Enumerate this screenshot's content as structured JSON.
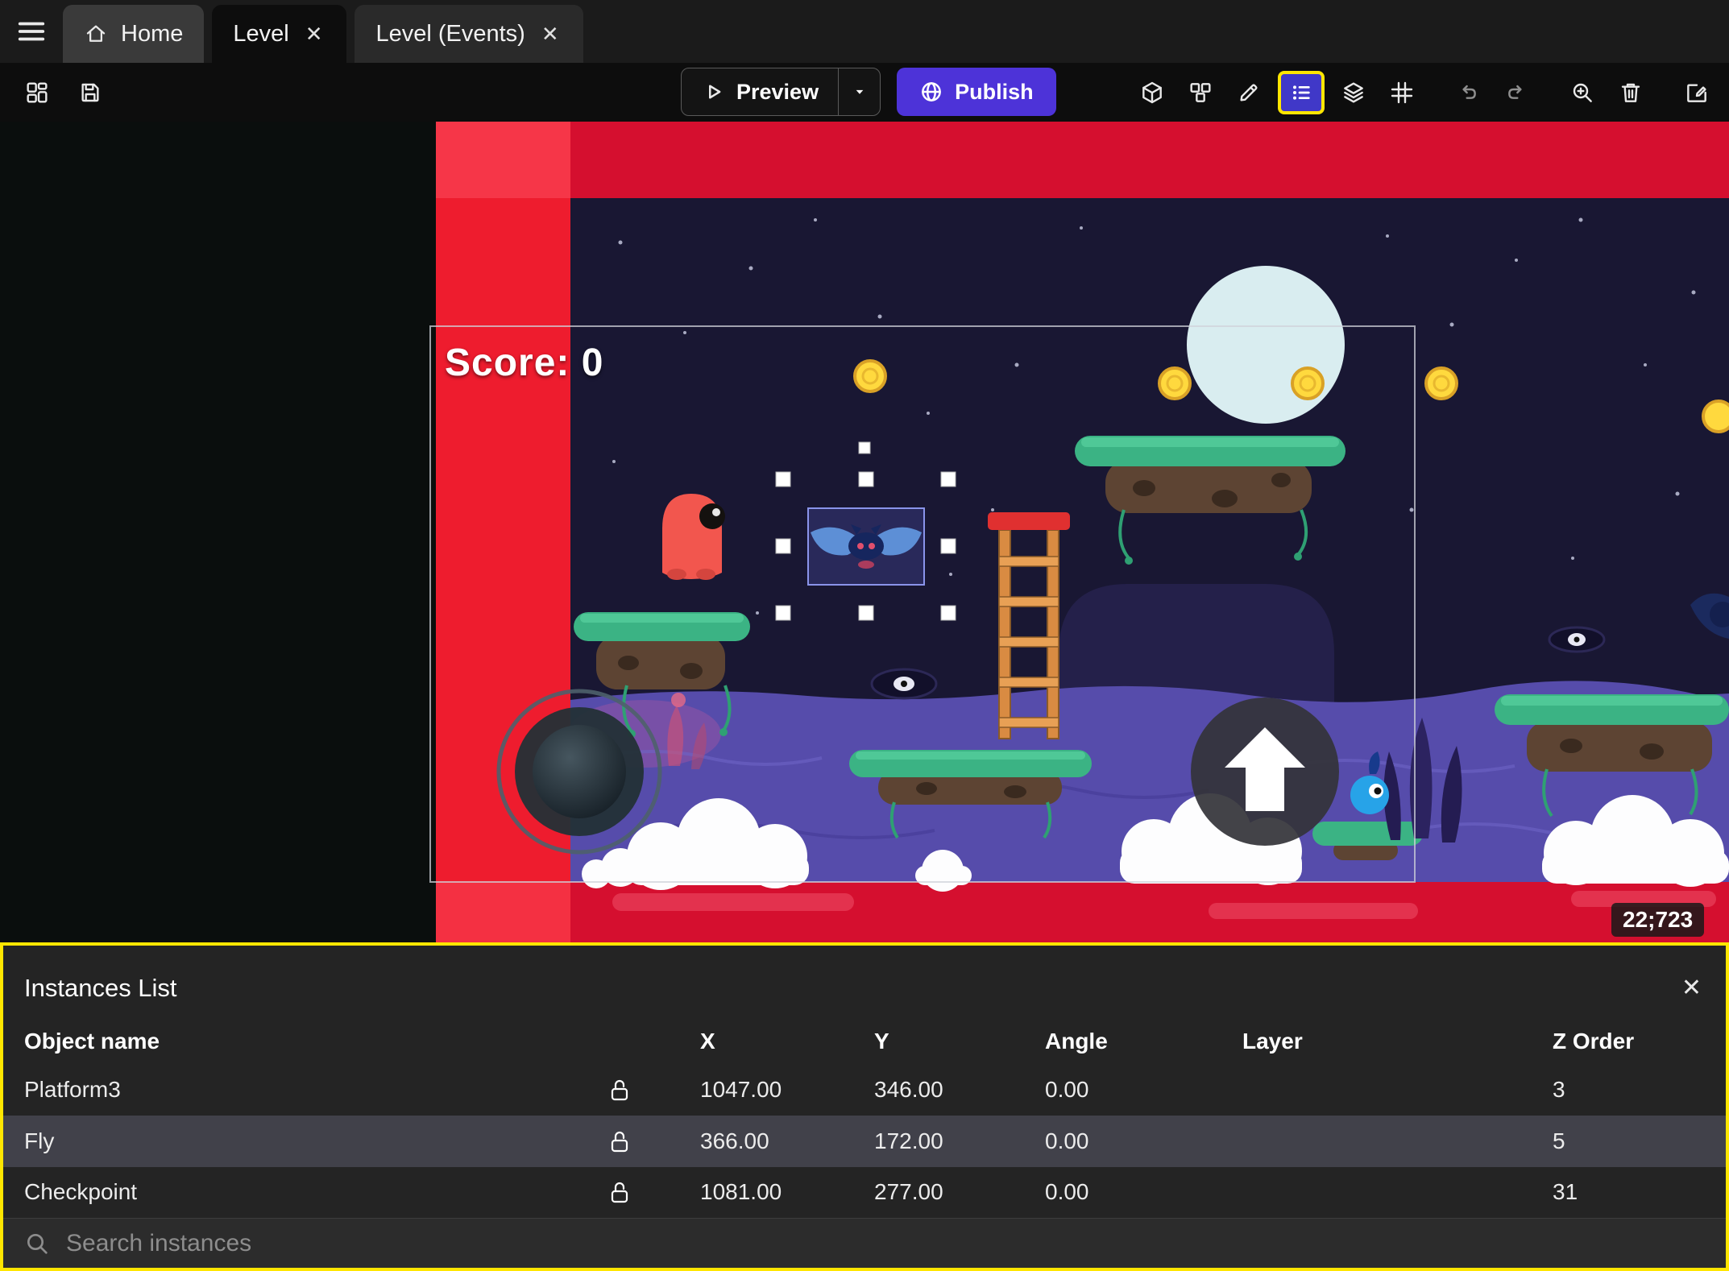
{
  "icons": {
    "close": "✕"
  },
  "tabbar": {
    "home": "Home",
    "level": "Level",
    "level_events": "Level (Events)"
  },
  "toolbar": {
    "preview": "Preview",
    "publish": "Publish"
  },
  "scene": {
    "score": "Score: 0",
    "coordinates": "22;723"
  },
  "instances_panel": {
    "title": "Instances List",
    "columns": {
      "name": "Object name",
      "x": "X",
      "y": "Y",
      "angle": "Angle",
      "layer": "Layer",
      "z_order": "Z Order"
    },
    "rows": [
      {
        "name": "Platform3",
        "x": "1047.00",
        "y": "346.00",
        "angle": "0.00",
        "layer": "",
        "z_order": "3"
      },
      {
        "name": "Fly",
        "x": "366.00",
        "y": "172.00",
        "angle": "0.00",
        "layer": "",
        "z_order": "5"
      },
      {
        "name": "Checkpoint",
        "x": "1081.00",
        "y": "277.00",
        "angle": "0.00",
        "layer": "",
        "z_order": "31"
      }
    ],
    "search_placeholder": "Search instances"
  },
  "colors": {
    "accent_purple": "#4d33d8",
    "highlight_yellow": "#ffe600",
    "red_band": "#d50f2f",
    "red_stripe": "#ee1c2e",
    "sky": "#191733"
  }
}
